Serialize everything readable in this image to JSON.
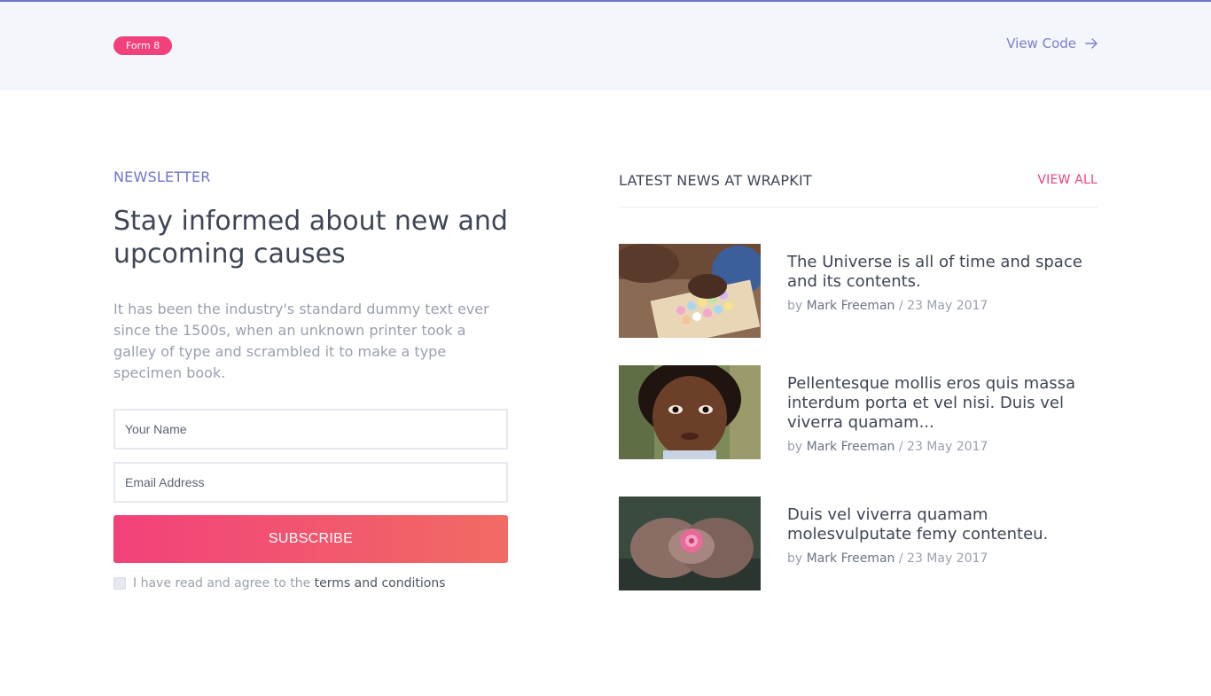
{
  "top": {
    "badge": "Form 8",
    "view_code_label": "View Code"
  },
  "newsletter": {
    "kicker": "NEWSLETTER",
    "headline": "Stay informed about new and upcoming causes",
    "description": "It has been the industry's standard dummy text ever since the 1500s, when an unknown printer took a galley of type and scrambled it to make a type specimen book.",
    "name_placeholder": "Your Name",
    "email_placeholder": "Email Address",
    "subscribe_label": "SUBSCRIBE",
    "agree_prefix": "I have read and agree to the",
    "terms_link": "terms and conditions"
  },
  "news": {
    "header_title": "LATEST NEWS AT WRAPKIT",
    "view_all_label": "VIEW ALL",
    "items": [
      {
        "title": "The Universe is all of time and space and its contents.",
        "by": "by",
        "author": "Mark Freeman",
        "separator": "/",
        "date": "23 May 2017",
        "image": "chalk-photo"
      },
      {
        "title": "Pellentesque mollis eros quis massa interdum porta et vel nisi. Duis vel viverra quamam...",
        "by": "by",
        "author": "Mark Freeman",
        "separator": "/",
        "date": "23 May 2017",
        "image": "child-portrait-photo"
      },
      {
        "title": "Duis vel viverra quamam molesvulputate femy contenteu.",
        "by": "by",
        "author": "Mark Freeman",
        "separator": "/",
        "date": "23 May 2017",
        "image": "hands-flower-photo"
      }
    ]
  },
  "colors": {
    "accent": "#6e74c9",
    "pink": "#f2417a",
    "text_dark": "#3e4555",
    "text_muted": "#9aa0b0"
  }
}
